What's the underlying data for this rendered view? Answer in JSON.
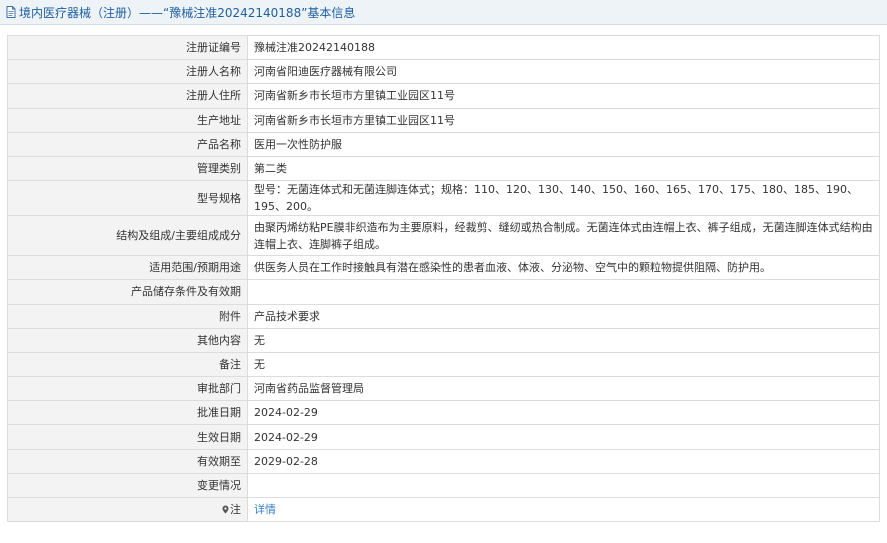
{
  "header": {
    "title": "境内医疗器械（注册）——“豫械注准20242140188”基本信息"
  },
  "rows": [
    {
      "label": "注册证编号",
      "value": "豫械注准20242140188"
    },
    {
      "label": "注册人名称",
      "value": "河南省阳迪医疗器械有限公司"
    },
    {
      "label": "注册人住所",
      "value": "河南省新乡市长垣市方里镇工业园区11号"
    },
    {
      "label": "生产地址",
      "value": "河南省新乡市长垣市方里镇工业园区11号"
    },
    {
      "label": "产品名称",
      "value": "医用一次性防护服"
    },
    {
      "label": "管理类别",
      "value": "第二类"
    },
    {
      "label": "型号规格",
      "value": "型号：无菌连体式和无菌连脚连体式；规格：110、120、130、140、150、160、165、170、175、180、185、190、195、200。"
    },
    {
      "label": "结构及组成/主要组成成分",
      "value": "由聚丙烯纺粘PE膜非织造布为主要原料，经裁剪、缝纫或热合制成。无菌连体式由连帽上衣、裤子组成，无菌连脚连体式结构由连帽上衣、连脚裤子组成。"
    },
    {
      "label": "适用范围/预期用途",
      "value": "供医务人员在工作时接触具有潜在感染性的患者血液、体液、分泌物、空气中的颗粒物提供阻隔、防护用。"
    },
    {
      "label": "产品储存条件及有效期",
      "value": ""
    },
    {
      "label": "附件",
      "value": "产品技术要求"
    },
    {
      "label": "其他内容",
      "value": "无"
    },
    {
      "label": "备注",
      "value": "无"
    },
    {
      "label": "审批部门",
      "value": "河南省药品监督管理局"
    },
    {
      "label": "批准日期",
      "value": "2024-02-29"
    },
    {
      "label": "生效日期",
      "value": "2024-02-29"
    },
    {
      "label": "有效期至",
      "value": "2029-02-28"
    },
    {
      "label": "变更情况",
      "value": ""
    },
    {
      "label": "注",
      "value": "详情"
    }
  ]
}
